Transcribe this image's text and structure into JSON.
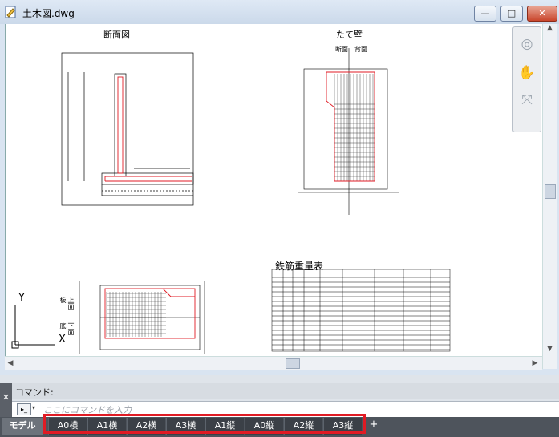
{
  "window": {
    "title": "土木図.dwg",
    "minimize_glyph": "—",
    "maximize_glyph": "□",
    "close_glyph": "✕"
  },
  "drawing": {
    "section_title": "断面図",
    "wall_title": "たて壁",
    "wall_subtitle": "断面　背面",
    "rebar_table_title": "鉄筋重量表",
    "ucs_y": "Y",
    "ucs_x": "X",
    "plan_upper_label": "上面",
    "plan_lower_label": "下面",
    "plan_top_side": "板",
    "plan_bottom_side": "底"
  },
  "command": {
    "history_label": "コマンド:",
    "placeholder": "ここにコマンドを入力",
    "close_glyph": "✕",
    "prompt_glyph": "▸_",
    "dropdown_glyph": "▾"
  },
  "tabs": {
    "model": "モデル",
    "layouts": [
      "A0横",
      "A1横",
      "A2横",
      "A3横",
      "A1縦",
      "A0縦",
      "A2縦",
      "A3縦"
    ],
    "add_glyph": "+"
  },
  "colors": {
    "highlight": "#e01b24",
    "rebar": "#e01b24",
    "canvas": "#ffffff"
  }
}
